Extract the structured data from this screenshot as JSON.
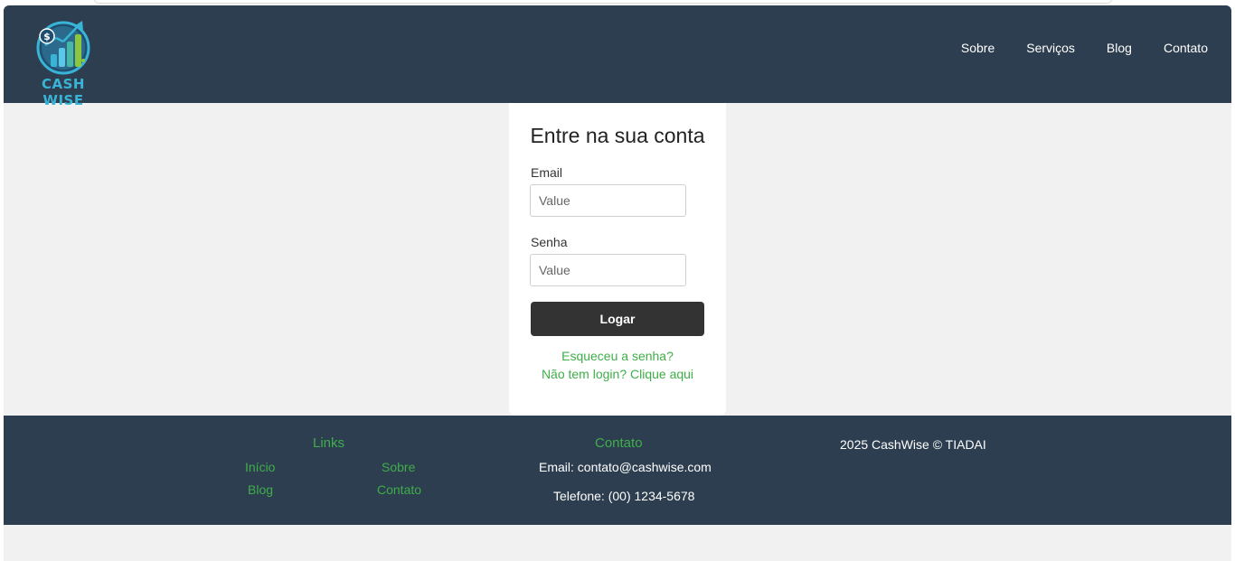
{
  "brand": {
    "name": "CASH WISE"
  },
  "nav": {
    "items": [
      "Sobre",
      "Serviços",
      "Blog",
      "Contato"
    ]
  },
  "login": {
    "title": "Entre na sua conta",
    "email_label": "Email",
    "email_placeholder": "Value",
    "password_label": "Senha",
    "password_placeholder": "Value",
    "submit_label": "Logar",
    "forgot_link": "Esqueceu a senha?",
    "register_link": "Não tem login? Clique aqui"
  },
  "footer": {
    "links_heading": "Links",
    "links": [
      "Início",
      "Sobre",
      "Blog",
      "Contato"
    ],
    "contact_heading": "Contato",
    "email": "Email: contato@cashwise.com",
    "phone": "Telefone: (00) 1234-5678",
    "copyright": "2025 CashWise © TIADAI"
  },
  "colors": {
    "header_bg": "#2d3e50",
    "page_bg": "#f1f1f1",
    "accent_green": "#3fae49",
    "button_bg": "#333333",
    "logo_blue": "#39b4d6"
  },
  "icons": {
    "logo": "coin-stacks-growth-chart-icon"
  }
}
